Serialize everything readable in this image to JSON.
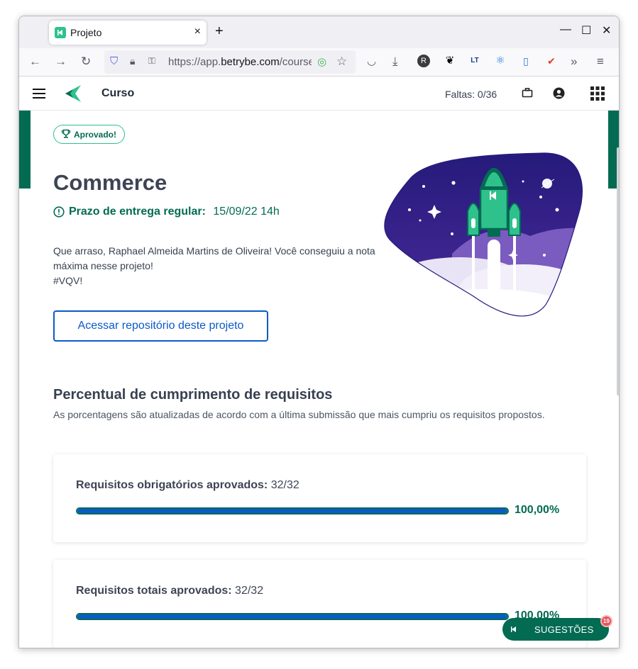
{
  "browser": {
    "tab_title": "Projeto",
    "tab_close": "×",
    "new_tab": "+",
    "url_prefix": "https://app.",
    "url_domain": "betrybe.com",
    "url_rest": "/course/..."
  },
  "app": {
    "course_label": "Curso",
    "faltas": "Faltas: 0/36"
  },
  "project": {
    "badge": "Aprovado!",
    "title": "Commerce",
    "deadline_label": "Prazo de entrega regular:",
    "deadline_value": "15/09/22 14h",
    "congrats_line1": "Que arraso, Raphael Almeida Martins de Oliveira! Você conseguiu a nota máxima nesse projeto!",
    "congrats_line2": "#VQV!",
    "repo_button": "Acessar repositório deste projeto"
  },
  "requirements": {
    "title": "Percentual de cumprimento de requisitos",
    "subtitle": "As porcentagens são atualizadas de acordo com a última submissão que mais cumpriu os requisitos propostos.",
    "cards": [
      {
        "label": "Requisitos obrigatórios aprovados:",
        "value": "32/32",
        "percent": "100,00%",
        "fill_fraction": 1.0
      },
      {
        "label": "Requisitos totais aprovados:",
        "value": "32/32",
        "percent": "100,00%",
        "fill_fraction": 1.0
      }
    ]
  },
  "suggestions": {
    "label": "SUGESTÕES",
    "count": "19"
  },
  "colors": {
    "brand_green": "#036b52",
    "accent_green": "#2fc18c",
    "link_blue": "#0a5ac7",
    "illustration_bg": "#2e1a87"
  }
}
